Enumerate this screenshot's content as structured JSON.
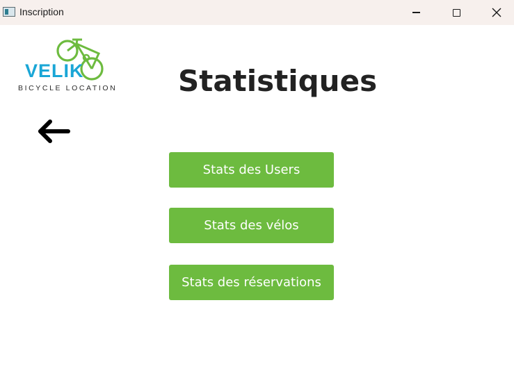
{
  "window": {
    "title": "Inscription",
    "icons": {
      "app": "app-window-icon",
      "minimize": "minimize-icon",
      "maximize": "maximize-icon",
      "close": "close-icon"
    }
  },
  "logo": {
    "name": "VELIK",
    "tagline": "BICYCLE LOCATION",
    "colors": {
      "text": "#1aa6d6",
      "bike": "#6dbb3f"
    }
  },
  "header": {
    "title": "Statistiques"
  },
  "nav": {
    "back_icon": "arrow-left-icon"
  },
  "buttons": {
    "users": "Stats des Users",
    "velos": "Stats des vélos",
    "reservations": "Stats des réservations"
  },
  "colors": {
    "button_bg": "#6dbb3f",
    "button_text": "#ffffff",
    "titlebar_bg": "#f7f0ed"
  }
}
